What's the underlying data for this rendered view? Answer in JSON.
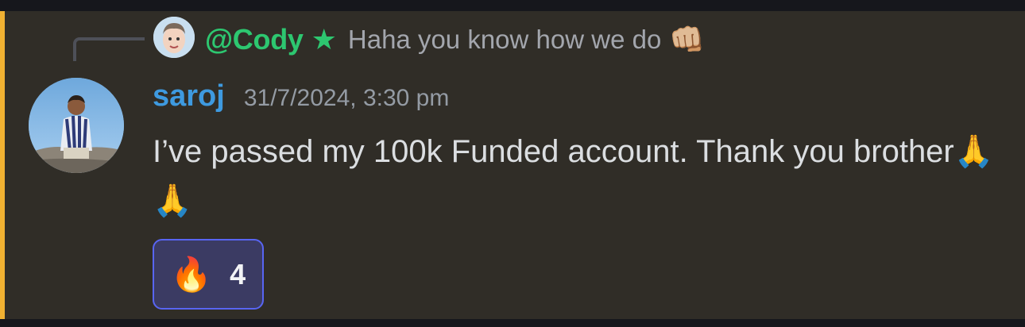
{
  "reply": {
    "mention": "@Cody",
    "badge_icon": "star-icon",
    "badge_glyph": "★",
    "text": "Haha you know how we do",
    "emoji": "👊🏼"
  },
  "message": {
    "author": "saroj",
    "timestamp": "31/7/2024, 3:30 pm",
    "content": "I’ve passed my 100k Funded account. Thank you brother",
    "content_emoji": "🙏🙏"
  },
  "reactions": [
    {
      "emoji": "🔥",
      "count": "4"
    }
  ],
  "colors": {
    "mention": "#2dc770",
    "username": "#3e9ae0",
    "highlight": "#f0b132",
    "reaction_border": "#5865f2"
  }
}
